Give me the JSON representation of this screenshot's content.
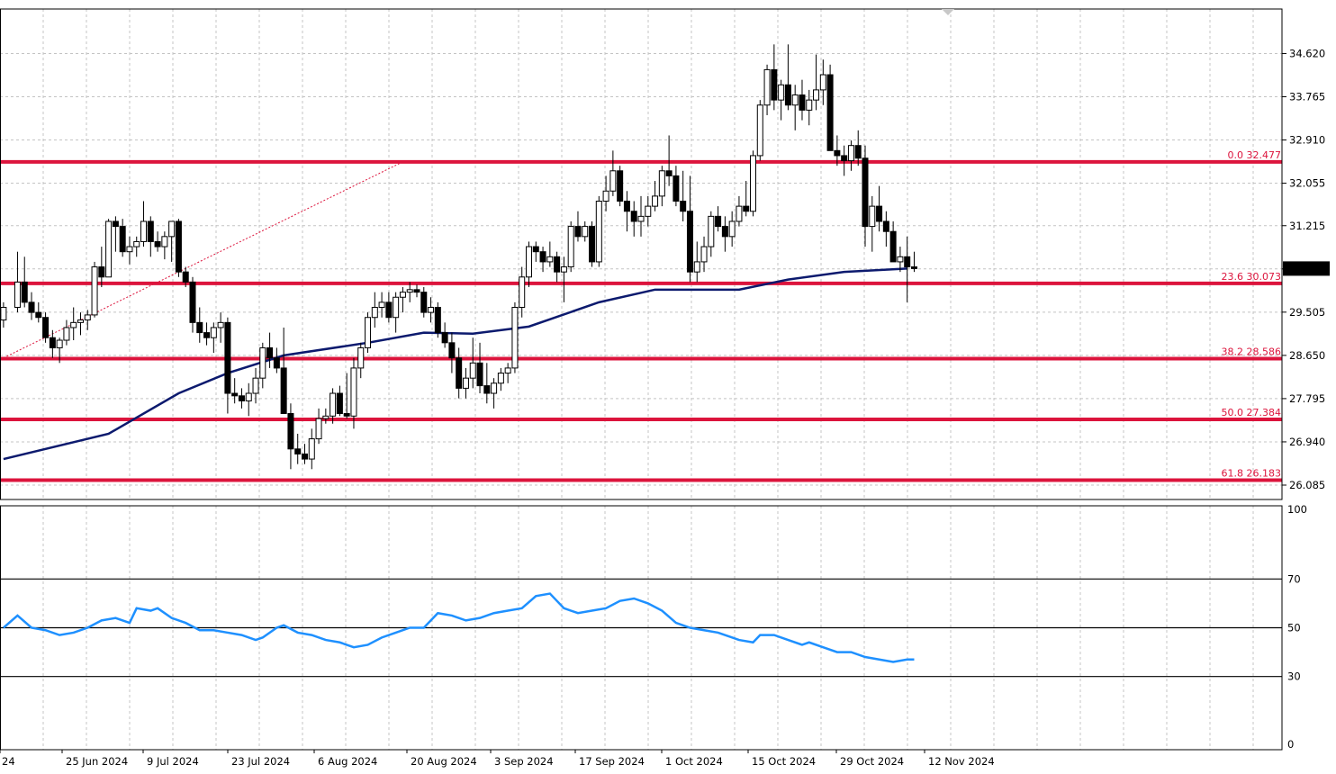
{
  "chart_data": [
    {
      "type": "candlestick",
      "panel": "price",
      "ylim": [
        25.8,
        35.5
      ],
      "y_ticks": [
        "34.620",
        "33.765",
        "32.910",
        "32.055",
        "31.215",
        "30.360",
        "29.505",
        "28.650",
        "27.795",
        "26.940",
        "26.085"
      ],
      "current_price": "30.367",
      "grid": true,
      "x_ticks": [
        "24",
        "25 Jun 2024",
        "9 Jul 2024",
        "23 Jul 2024",
        "6 Aug 2024",
        "20 Aug 2024",
        "3 Sep 2024",
        "17 Sep 2024",
        "1 Oct 2024",
        "15 Oct 2024",
        "29 Oct 2024",
        "12 Nov 2024"
      ],
      "fib_levels": [
        {
          "label": "0.0 32.477",
          "value": 32.477
        },
        {
          "label": "23.6 30.073",
          "value": 30.073
        },
        {
          "label": "38.2 28.586",
          "value": 28.586
        },
        {
          "label": "50.0 27.384",
          "value": 27.384
        },
        {
          "label": "61.8 26.183",
          "value": 26.183
        }
      ],
      "trendline": {
        "from": [
          0,
          28.6
        ],
        "to": [
          57,
          32.477
        ]
      },
      "ma_series": [
        [
          0,
          26.6
        ],
        [
          15,
          27.1
        ],
        [
          25,
          27.9
        ],
        [
          32,
          28.3
        ],
        [
          40,
          28.65
        ],
        [
          52,
          28.9
        ],
        [
          60,
          29.1
        ],
        [
          67,
          29.08
        ],
        [
          75,
          29.22
        ],
        [
          85,
          29.7
        ],
        [
          93,
          29.95
        ],
        [
          98,
          29.95
        ],
        [
          105,
          29.95
        ],
        [
          112,
          30.15
        ],
        [
          120,
          30.3
        ],
        [
          129,
          30.367
        ]
      ],
      "candles": [
        [
          0,
          29.35,
          29.7,
          29.2,
          29.6
        ],
        [
          2,
          29.6,
          30.7,
          29.5,
          30.1
        ],
        [
          3,
          30.1,
          30.6,
          29.6,
          29.7
        ],
        [
          4,
          29.7,
          29.9,
          29.35,
          29.5
        ],
        [
          5,
          29.5,
          29.7,
          29.3,
          29.4
        ],
        [
          6,
          29.4,
          29.5,
          28.9,
          29.0
        ],
        [
          7,
          29.0,
          29.15,
          28.6,
          28.8
        ],
        [
          8,
          28.8,
          29.0,
          28.5,
          28.95
        ],
        [
          9,
          28.95,
          29.35,
          28.85,
          29.2
        ],
        [
          10,
          29.2,
          29.6,
          28.95,
          29.3
        ],
        [
          11,
          29.3,
          29.5,
          29.05,
          29.35
        ],
        [
          12,
          29.35,
          29.55,
          29.15,
          29.45
        ],
        [
          13,
          29.45,
          30.5,
          29.4,
          30.4
        ],
        [
          14,
          30.4,
          30.8,
          30.0,
          30.2
        ],
        [
          15,
          30.2,
          31.35,
          30.2,
          31.3
        ],
        [
          16,
          31.3,
          31.4,
          30.7,
          31.2
        ],
        [
          17,
          31.2,
          31.35,
          30.6,
          30.7
        ],
        [
          18,
          30.7,
          31.0,
          30.45,
          30.8
        ],
        [
          19,
          30.8,
          31.0,
          30.6,
          30.9
        ],
        [
          20,
          30.9,
          31.7,
          30.8,
          31.3
        ],
        [
          21,
          31.3,
          31.4,
          30.6,
          30.9
        ],
        [
          22,
          30.9,
          31.1,
          30.7,
          30.8
        ],
        [
          23,
          30.8,
          31.1,
          30.55,
          31.0
        ],
        [
          24,
          31.0,
          31.1,
          30.5,
          31.3
        ],
        [
          25,
          31.3,
          31.35,
          30.2,
          30.3
        ],
        [
          26,
          30.3,
          30.4,
          30.0,
          30.1
        ],
        [
          27,
          30.1,
          30.2,
          29.1,
          29.3
        ],
        [
          28,
          29.3,
          29.6,
          28.9,
          29.1
        ],
        [
          29,
          29.1,
          29.3,
          28.85,
          29.0
        ],
        [
          30,
          29.0,
          29.3,
          28.7,
          29.2
        ],
        [
          31,
          29.2,
          29.5,
          28.9,
          29.3
        ],
        [
          32,
          29.3,
          29.4,
          27.5,
          27.9
        ],
        [
          33,
          27.9,
          28.2,
          27.7,
          27.85
        ],
        [
          34,
          27.85,
          28.0,
          27.6,
          27.75
        ],
        [
          35,
          27.75,
          28.1,
          27.45,
          27.9
        ],
        [
          36,
          27.9,
          28.4,
          27.7,
          28.2
        ],
        [
          37,
          28.2,
          28.9,
          28.0,
          28.8
        ],
        [
          38,
          28.8,
          29.1,
          28.4,
          28.6
        ],
        [
          39,
          28.6,
          28.8,
          28.3,
          28.4
        ],
        [
          40,
          28.4,
          29.2,
          27.8,
          27.5
        ],
        [
          41,
          27.5,
          27.7,
          26.4,
          26.8
        ],
        [
          42,
          26.8,
          27.1,
          26.5,
          26.7
        ],
        [
          43,
          26.7,
          26.9,
          26.5,
          26.6
        ],
        [
          44,
          26.6,
          27.2,
          26.4,
          27.0
        ],
        [
          45,
          27.0,
          27.6,
          26.9,
          27.4
        ],
        [
          46,
          27.4,
          27.6,
          27.3,
          27.45
        ],
        [
          47,
          27.45,
          28.0,
          27.3,
          27.9
        ],
        [
          48,
          27.9,
          28.05,
          27.45,
          27.5
        ],
        [
          49,
          27.5,
          28.3,
          27.4,
          27.45
        ],
        [
          50,
          27.45,
          28.6,
          27.2,
          28.4
        ],
        [
          51,
          28.4,
          28.9,
          28.2,
          28.8
        ],
        [
          52,
          28.8,
          29.5,
          28.7,
          29.4
        ],
        [
          53,
          29.4,
          29.9,
          29.2,
          29.6
        ],
        [
          54,
          29.6,
          29.9,
          29.4,
          29.7
        ],
        [
          55,
          29.7,
          29.9,
          29.3,
          29.4
        ],
        [
          56,
          29.4,
          29.9,
          29.1,
          29.8
        ],
        [
          57,
          29.8,
          30.0,
          29.5,
          29.9
        ],
        [
          58,
          29.9,
          30.1,
          29.7,
          29.95
        ],
        [
          59,
          29.95,
          30.05,
          29.8,
          29.9
        ],
        [
          60,
          29.9,
          30.0,
          29.4,
          29.5
        ],
        [
          61,
          29.5,
          29.8,
          29.3,
          29.6
        ],
        [
          62,
          29.6,
          29.7,
          29.0,
          29.1
        ],
        [
          63,
          29.1,
          29.3,
          28.8,
          28.9
        ],
        [
          64,
          28.9,
          29.1,
          28.3,
          28.6
        ],
        [
          65,
          28.6,
          28.8,
          27.8,
          28.0
        ],
        [
          66,
          28.0,
          28.4,
          27.8,
          28.2
        ],
        [
          67,
          28.2,
          29.0,
          28.0,
          28.5
        ],
        [
          68,
          28.5,
          28.9,
          27.9,
          28.05
        ],
        [
          69,
          28.05,
          28.5,
          27.7,
          27.9
        ],
        [
          70,
          27.9,
          28.2,
          27.6,
          28.1
        ],
        [
          71,
          28.1,
          28.4,
          27.95,
          28.3
        ],
        [
          72,
          28.3,
          28.5,
          28.1,
          28.4
        ],
        [
          73,
          28.4,
          29.7,
          28.3,
          29.6
        ],
        [
          74,
          29.6,
          30.4,
          29.4,
          30.2
        ],
        [
          75,
          30.2,
          30.9,
          30.0,
          30.8
        ],
        [
          76,
          30.8,
          30.9,
          30.5,
          30.7
        ],
        [
          77,
          30.7,
          30.8,
          30.3,
          30.5
        ],
        [
          78,
          30.5,
          30.9,
          30.4,
          30.6
        ],
        [
          79,
          30.6,
          30.7,
          30.1,
          30.3
        ],
        [
          80,
          30.3,
          30.6,
          29.7,
          30.4
        ],
        [
          81,
          30.4,
          31.3,
          30.3,
          31.2
        ],
        [
          82,
          31.2,
          31.5,
          30.9,
          31.0
        ],
        [
          83,
          31.0,
          31.3,
          30.9,
          31.2
        ],
        [
          84,
          31.2,
          31.3,
          30.4,
          30.5
        ],
        [
          85,
          30.5,
          31.8,
          30.4,
          31.7
        ],
        [
          86,
          31.7,
          32.2,
          31.5,
          31.9
        ],
        [
          87,
          31.9,
          32.7,
          31.8,
          32.3
        ],
        [
          88,
          32.3,
          32.4,
          31.6,
          31.7
        ],
        [
          89,
          31.7,
          31.9,
          31.1,
          31.5
        ],
        [
          90,
          31.5,
          31.7,
          31.0,
          31.3
        ],
        [
          91,
          31.3,
          31.8,
          31.0,
          31.4
        ],
        [
          92,
          31.4,
          31.8,
          31.2,
          31.6
        ],
        [
          93,
          31.6,
          32.1,
          31.5,
          31.8
        ],
        [
          94,
          31.8,
          32.4,
          31.6,
          32.3
        ],
        [
          95,
          32.3,
          33.0,
          32.0,
          32.2
        ],
        [
          96,
          32.2,
          32.4,
          31.6,
          31.7
        ],
        [
          97,
          31.7,
          32.3,
          31.3,
          31.5
        ],
        [
          98,
          31.5,
          32.2,
          30.1,
          30.3
        ],
        [
          99,
          30.3,
          30.9,
          30.1,
          30.5
        ],
        [
          100,
          30.5,
          31.0,
          30.3,
          30.8
        ],
        [
          101,
          30.8,
          31.5,
          30.6,
          31.4
        ],
        [
          102,
          31.4,
          31.6,
          31.1,
          31.2
        ],
        [
          103,
          31.2,
          31.4,
          30.7,
          31.0
        ],
        [
          104,
          31.0,
          31.5,
          30.8,
          31.3
        ],
        [
          105,
          31.3,
          31.8,
          31.2,
          31.6
        ],
        [
          106,
          31.6,
          32.1,
          31.4,
          31.5
        ],
        [
          107,
          31.5,
          32.7,
          31.4,
          32.6
        ],
        [
          108,
          32.6,
          33.7,
          32.5,
          33.6
        ],
        [
          109,
          33.6,
          34.4,
          33.4,
          34.3
        ],
        [
          110,
          34.3,
          34.8,
          33.5,
          33.7
        ],
        [
          111,
          33.7,
          34.1,
          33.3,
          34.0
        ],
        [
          112,
          34.0,
          34.8,
          33.5,
          33.6
        ],
        [
          113,
          33.6,
          34.0,
          33.1,
          33.8
        ],
        [
          114,
          33.8,
          34.1,
          33.3,
          33.5
        ],
        [
          115,
          33.5,
          33.9,
          33.2,
          33.7
        ],
        [
          116,
          33.7,
          34.6,
          33.5,
          33.9
        ],
        [
          117,
          33.9,
          34.5,
          33.6,
          34.2
        ],
        [
          118,
          34.2,
          34.4,
          32.9,
          32.7
        ],
        [
          119,
          32.7,
          33.0,
          32.4,
          32.6
        ],
        [
          120,
          32.6,
          32.8,
          32.2,
          32.5
        ],
        [
          121,
          32.5,
          32.9,
          32.3,
          32.8
        ],
        [
          122,
          32.8,
          33.1,
          32.4,
          32.55
        ],
        [
          123,
          32.55,
          32.8,
          30.8,
          31.2
        ],
        [
          124,
          31.2,
          31.8,
          30.7,
          31.6
        ],
        [
          125,
          31.6,
          32.0,
          31.1,
          31.3
        ],
        [
          126,
          31.3,
          31.5,
          30.8,
          31.1
        ],
        [
          127,
          31.1,
          31.3,
          30.5,
          30.5
        ],
        [
          128,
          30.5,
          30.8,
          30.3,
          30.6
        ],
        [
          129,
          30.6,
          31.0,
          29.7,
          30.4
        ],
        [
          130,
          30.4,
          30.7,
          30.3,
          30.367
        ]
      ]
    },
    {
      "type": "line",
      "panel": "oscillator",
      "ylim": [
        0,
        100
      ],
      "y_ticks": [
        "100",
        "70",
        "50",
        "30",
        "0"
      ],
      "levels": [
        70,
        50,
        30
      ],
      "values": [
        [
          0,
          50
        ],
        [
          2,
          55
        ],
        [
          4,
          50
        ],
        [
          6,
          49
        ],
        [
          8,
          47
        ],
        [
          10,
          48
        ],
        [
          12,
          50
        ],
        [
          14,
          53
        ],
        [
          16,
          54
        ],
        [
          18,
          52
        ],
        [
          19,
          58
        ],
        [
          21,
          57
        ],
        [
          22,
          58
        ],
        [
          24,
          54
        ],
        [
          26,
          52
        ],
        [
          28,
          49
        ],
        [
          30,
          49
        ],
        [
          32,
          48
        ],
        [
          34,
          47
        ],
        [
          36,
          45
        ],
        [
          37,
          46
        ],
        [
          39,
          50
        ],
        [
          40,
          51
        ],
        [
          42,
          48
        ],
        [
          44,
          47
        ],
        [
          46,
          45
        ],
        [
          48,
          44
        ],
        [
          50,
          42
        ],
        [
          52,
          43
        ],
        [
          54,
          46
        ],
        [
          56,
          48
        ],
        [
          58,
          50
        ],
        [
          60,
          50
        ],
        [
          62,
          56
        ],
        [
          64,
          55
        ],
        [
          66,
          53
        ],
        [
          68,
          54
        ],
        [
          70,
          56
        ],
        [
          72,
          57
        ],
        [
          74,
          58
        ],
        [
          76,
          63
        ],
        [
          78,
          64
        ],
        [
          80,
          58
        ],
        [
          82,
          56
        ],
        [
          84,
          57
        ],
        [
          86,
          58
        ],
        [
          88,
          61
        ],
        [
          90,
          62
        ],
        [
          92,
          60
        ],
        [
          94,
          57
        ],
        [
          96,
          52
        ],
        [
          98,
          50
        ],
        [
          100,
          49
        ],
        [
          102,
          48
        ],
        [
          104,
          46
        ],
        [
          105,
          45
        ],
        [
          107,
          44
        ],
        [
          108,
          47
        ],
        [
          110,
          47
        ],
        [
          112,
          45
        ],
        [
          114,
          43
        ],
        [
          115,
          44
        ],
        [
          117,
          42
        ],
        [
          119,
          40
        ],
        [
          121,
          40
        ],
        [
          123,
          38
        ],
        [
          125,
          37
        ],
        [
          127,
          36
        ],
        [
          129,
          37
        ],
        [
          130,
          37
        ]
      ]
    }
  ]
}
